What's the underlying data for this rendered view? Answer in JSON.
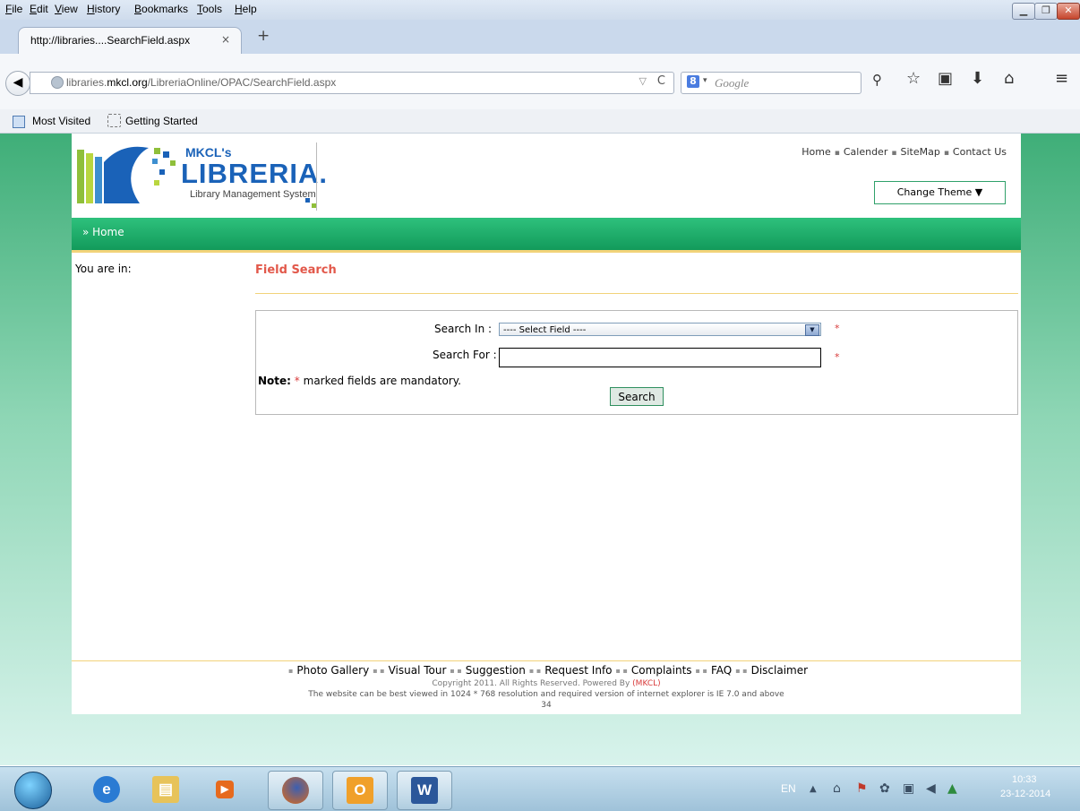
{
  "browser": {
    "menu": [
      "File",
      "Edit",
      "View",
      "History",
      "Bookmarks",
      "Tools",
      "Help"
    ],
    "tab_title": "http://libraries....SearchField.aspx",
    "tab_close": "×",
    "new_tab": "+",
    "url_host": "libraries.",
    "url_domain": "mkcl.org",
    "url_path": "/LibreriaOnline/OPAC/SearchField.aspx",
    "search_engine": "8",
    "search_placeholder": "Google",
    "bookmarks": [
      "Most Visited",
      "Getting Started"
    ]
  },
  "site": {
    "logo_brand": "MKCL's",
    "logo_name": "LIBRERIA.",
    "logo_tagline": "Library Management System",
    "top_links": [
      "Home",
      "Calender",
      "SiteMap",
      "Contact Us"
    ],
    "change_theme": "Change Theme ▼",
    "nav_home": "» Home",
    "you_are_in": "You are in:"
  },
  "form": {
    "title": "Field Search",
    "search_in_label": "Search In :",
    "search_in_value": "---- Select Field ----",
    "search_for_label": "Search For :",
    "search_for_value": "",
    "required_mark": "*",
    "note_label": "Note:",
    "note_mark": "*",
    "note_text": "marked fields are mandatory.",
    "search_button": "Search"
  },
  "footer": {
    "links": [
      "Photo Gallery",
      "Visual Tour",
      "Suggestion",
      "Request Info",
      "Complaints",
      "FAQ",
      "Disclaimer"
    ],
    "copyright": "Copyright 2011. All Rights Reserved. Powered By",
    "powered_by": "(MKCL)",
    "best_view": "The website can be best viewed in 1024 * 768 resolution and required version of internet explorer is IE 7.0 and above",
    "visitor_count": "34"
  },
  "taskbar": {
    "language": "EN",
    "time": "10:33",
    "date": "23-12-2014"
  },
  "colors": {
    "accent_green": "#129a5b",
    "title_red": "#e2584a",
    "brand_blue": "#1a62b8"
  }
}
